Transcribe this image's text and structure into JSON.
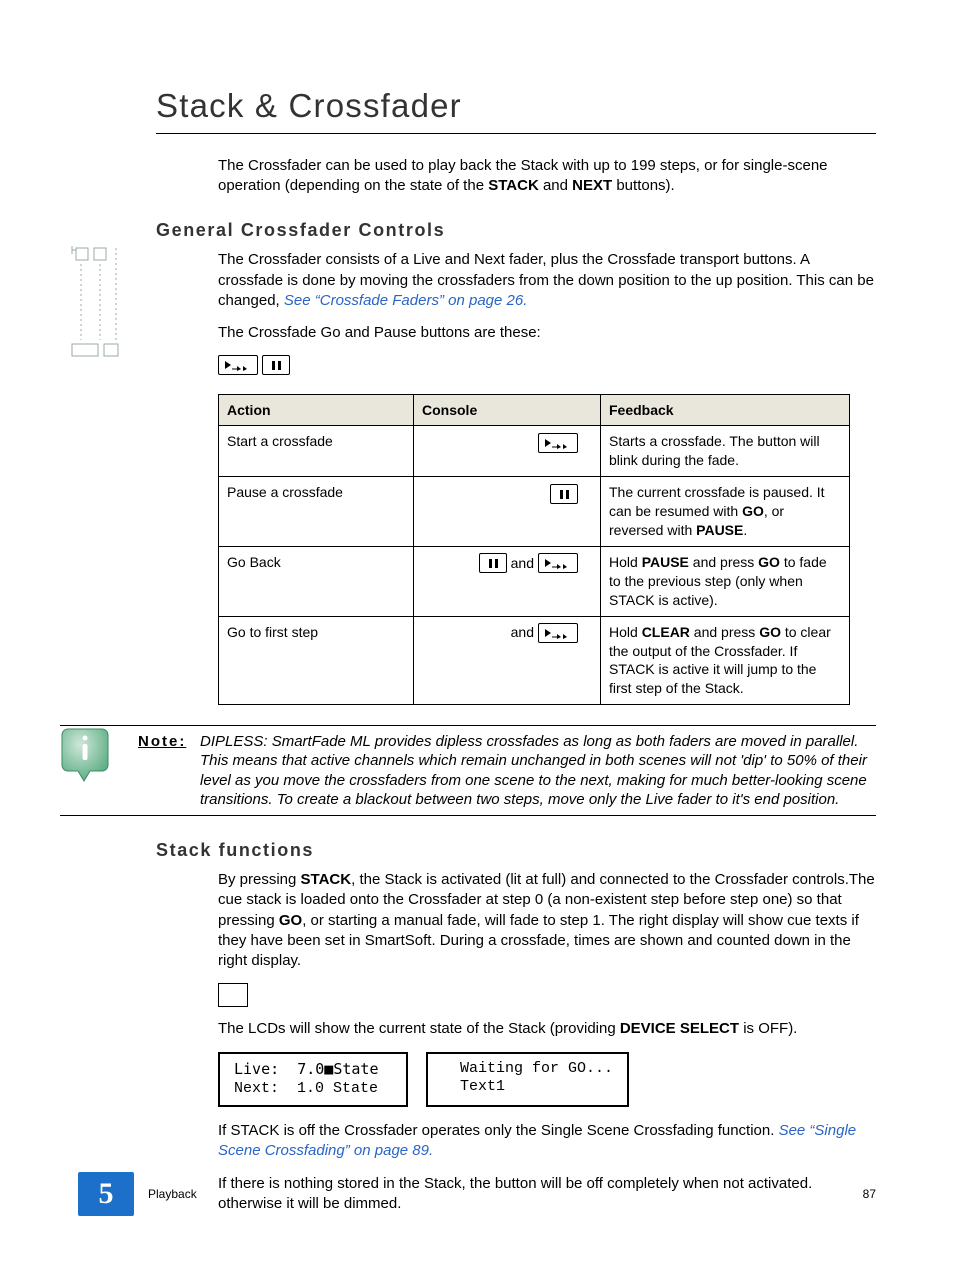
{
  "title": "Stack & Crossfader",
  "intro_before_stack": "The Crossfader can be used to play back the Stack with up to 199 steps, or for single-scene operation (depending on the state of the ",
  "intro_stack": "STACK",
  "intro_mid": " and ",
  "intro_next": "NEXT",
  "intro_after": " buttons).",
  "sec1_heading": "General Crossfader Controls",
  "sec1_p1_a": "The Crossfader consists of a Live and Next fader, plus the Crossfade transport buttons. A crossfade is done by moving the crossfaders from the down position to the up position. This can be changed, ",
  "sec1_p1_link": "See “Crossfade Faders” on page 26.",
  "sec1_p2": "The Crossfade Go and Pause buttons are these:",
  "table": {
    "h_action": "Action",
    "h_console": "Console",
    "h_feedback": "Feedback",
    "r1_action": "Start a crossfade",
    "r1_feedback": "Starts a crossfade. The button will blink during the fade.",
    "r2_action": "Pause a crossfade",
    "r2_feedback_a": "The current crossfade is paused. It can be resumed with ",
    "r2_feedback_go": "GO",
    "r2_feedback_mid": ", or reversed with ",
    "r2_feedback_pause": "PAUSE",
    "r2_feedback_end": ".",
    "r3_action": "Go Back",
    "r3_and": "and",
    "r3_feedback_a": "Hold ",
    "r3_feedback_pause": "PAUSE",
    "r3_feedback_b": " and press ",
    "r3_feedback_go": "GO",
    "r3_feedback_c": " to fade to the previous step (only when STACK is active).",
    "r4_action": "Go to first step",
    "r4_and": "and",
    "r4_feedback_a": "Hold ",
    "r4_feedback_clear": "CLEAR",
    "r4_feedback_b": " and press ",
    "r4_feedback_go": "GO",
    "r4_feedback_c": " to clear the output of the Crossfader. If STACK is active it will jump to the first step of the Stack."
  },
  "note_label": "Note:",
  "note_text": "DIPLESS: SmartFade ML provides dipless crossfades as long as both faders are moved in parallel. This means that active channels which remain unchanged in both scenes will not 'dip' to 50% of their level as you move the crossfaders from one scene to the next, making for much better-looking scene transitions. To create a blackout between two steps, move only the Live fader to it's end position.",
  "sec2_heading": "Stack functions",
  "sec2_p1_a": "By pressing ",
  "sec2_p1_stack": "STACK",
  "sec2_p1_b": ", the Stack is activated (lit at full) and connected to the Crossfader controls.The cue stack is loaded onto the Crossfader at step 0 (a non-existent step before step one) so that pressing ",
  "sec2_p1_go": "GO",
  "sec2_p1_c": ", or starting a manual fade, will fade to step 1. The right display will show cue texts if they have been set in SmartSoft. During a crossfade, times are shown and counted down in the right display.",
  "sec2_p2_a": "The LCDs will show the current state of the Stack (providing ",
  "sec2_p2_dev": "DEVICE SELECT",
  "sec2_p2_b": " is OFF).",
  "lcd1_line1": "Live:  7.0■State",
  "lcd1_line2": "Next:  1.0 State",
  "lcd2_line1": "  Waiting for GO...",
  "lcd2_line2": "  Text1",
  "sec2_p3_a": "If STACK is off the Crossfader operates only the Single Scene Crossfading function. ",
  "sec2_p3_link": "See “Single Scene Crossfading” on page 89.",
  "sec2_p4": "If there is nothing stored in the Stack, the button will be off completely when not activated. otherwise it will be dimmed.",
  "footer_chapnum": "5",
  "footer_section": "Playback",
  "footer_page": "87"
}
